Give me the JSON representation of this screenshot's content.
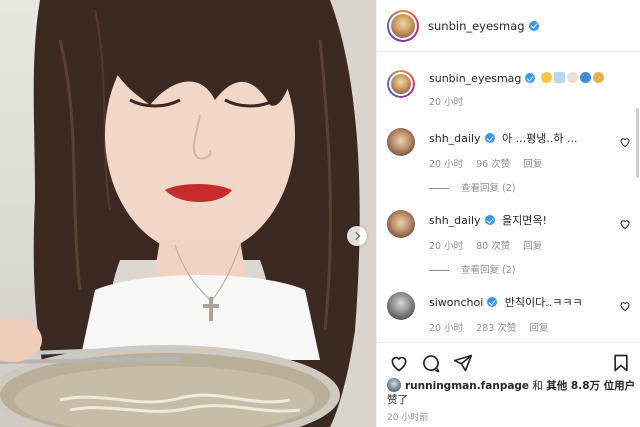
{
  "post": {
    "author": "sunbin_eyesmag",
    "caption_time": "20 小时",
    "emojis": [
      "#f6c343",
      "#b9d7ef",
      "#e8e0d5",
      "#3a8fd8",
      "#e8b04a"
    ]
  },
  "comments": [
    {
      "user": "shh_daily",
      "text": "아 ...평냉..하 ...",
      "time": "20 小时",
      "likes": "96 次赞",
      "reply": "回复",
      "view_replies": "查看回复 (2)"
    },
    {
      "user": "shh_daily",
      "text": "을지면옥!",
      "time": "20 小时",
      "likes": "80 次赞",
      "reply": "回复",
      "view_replies": "查看回复 (2)"
    },
    {
      "user": "siwonchoi",
      "text": "반칙이다..ㅋㅋㅋ",
      "time": "20 小时",
      "likes": "283 次赞",
      "reply": "回复"
    }
  ],
  "likes": {
    "user": "runningman.fanpage",
    "and": "和",
    "others": "其他 8.8万 位用户",
    "liked": "赞了"
  },
  "posted_time": "20 小时前",
  "icons": {
    "verified": "verified-badge-icon",
    "like": "heart-icon",
    "comment": "comment-icon",
    "share": "send-icon",
    "save": "bookmark-icon",
    "next": "chevron-right-icon"
  },
  "colors": {
    "verified": "#3897f0",
    "muted": "#8e8e8e",
    "text": "#262626"
  }
}
